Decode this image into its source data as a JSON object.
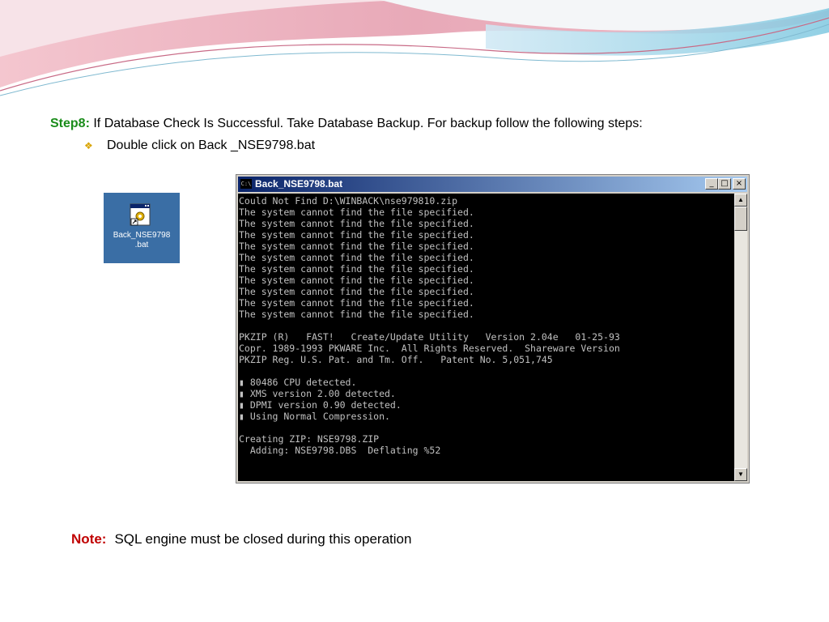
{
  "slide": {
    "step_label": "Step8:",
    "step_text": " If Database Check Is Successful. Take Database Backup. For  backup follow the following steps:",
    "bullet_text": "Double click on Back _NSE9798.bat",
    "desktop_icon": {
      "label_line1": "Back_NSE9798",
      "label_line2": ".bat",
      "icon": "batch-file-icon"
    },
    "note_label": "Note:",
    "note_text": "SQL engine must be closed during this operation"
  },
  "cmd_window": {
    "title": "Back_NSE9798.bat",
    "icon_text": "C:\\",
    "buttons": {
      "minimize": "_",
      "maximize": "□",
      "close": "×"
    },
    "scroll_up": "▲",
    "scroll_down": "▼",
    "output": "Could Not Find D:\\WINBACK\\nse979810.zip\nThe system cannot find the file specified.\nThe system cannot find the file specified.\nThe system cannot find the file specified.\nThe system cannot find the file specified.\nThe system cannot find the file specified.\nThe system cannot find the file specified.\nThe system cannot find the file specified.\nThe system cannot find the file specified.\nThe system cannot find the file specified.\nThe system cannot find the file specified.\n\nPKZIP (R)   FAST!   Create/Update Utility   Version 2.04e   01-25-93\nCopr. 1989-1993 PKWARE Inc.  All Rights Reserved.  Shareware Version\nPKZIP Reg. U.S. Pat. and Tm. Off.   Patent No. 5,051,745\n\n▮ 80486 CPU detected.\n▮ XMS version 2.00 detected.\n▮ DPMI version 0.90 detected.\n▮ Using Normal Compression.\n\nCreating ZIP: NSE9798.ZIP\n  Adding: NSE9798.DBS  Deflating %52"
  },
  "colors": {
    "step_label": "#1a8c1a",
    "note_label": "#c00000",
    "desktop_background": "#3a6ea5",
    "titlebar": "#0a246a"
  }
}
